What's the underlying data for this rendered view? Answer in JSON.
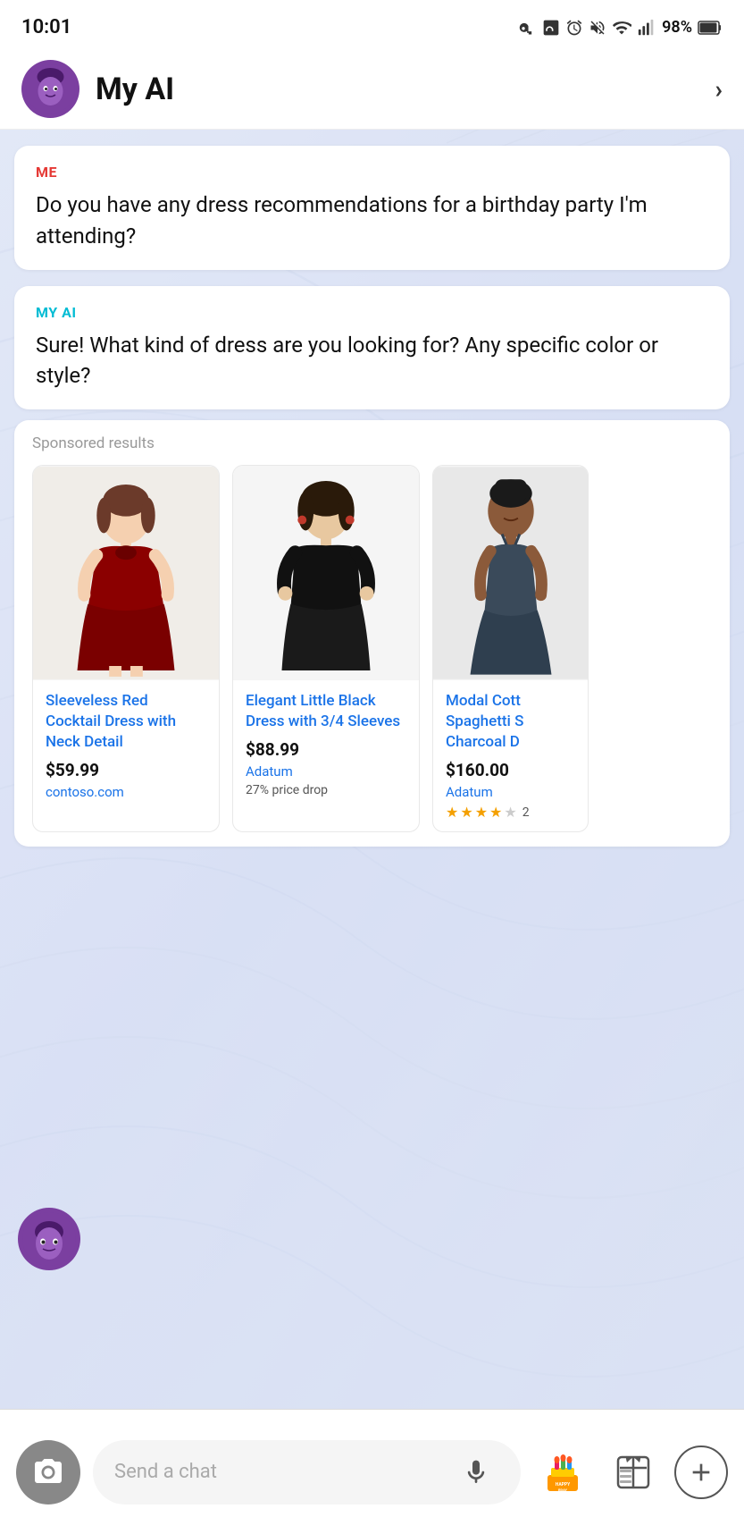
{
  "statusBar": {
    "time": "10:01",
    "battery": "98%"
  },
  "header": {
    "title": "My AI",
    "chevronLabel": "›"
  },
  "messages": [
    {
      "id": "msg1",
      "senderLabel": "ME",
      "senderType": "me",
      "text": "Do you have any dress recommendations for a birthday party I'm attending?"
    },
    {
      "id": "msg2",
      "senderLabel": "MY AI",
      "senderType": "ai",
      "text": "Sure! What kind of dress are you looking for? Any specific color or style?"
    }
  ],
  "sponsored": {
    "label": "Sponsored results",
    "products": [
      {
        "id": "prod1",
        "name": "Sleeveless Red Cocktail Dress with Neck Detail",
        "price": "$59.99",
        "store": "contoso.com",
        "badge": "",
        "stars": 0,
        "starsCount": ""
      },
      {
        "id": "prod2",
        "name": "Elegant Little Black Dress with 3/4 Sleeves",
        "price": "$88.99",
        "store": "Adatum",
        "badge": "27% price drop",
        "stars": 0,
        "starsCount": ""
      },
      {
        "id": "prod3",
        "name": "Modal Cott Spaghetti S Charcoal D",
        "price": "$160.00",
        "store": "Adatum",
        "badge": "",
        "stars": 4,
        "starsCount": "2"
      }
    ]
  },
  "bottomBar": {
    "inputPlaceholder": "Send a chat"
  }
}
